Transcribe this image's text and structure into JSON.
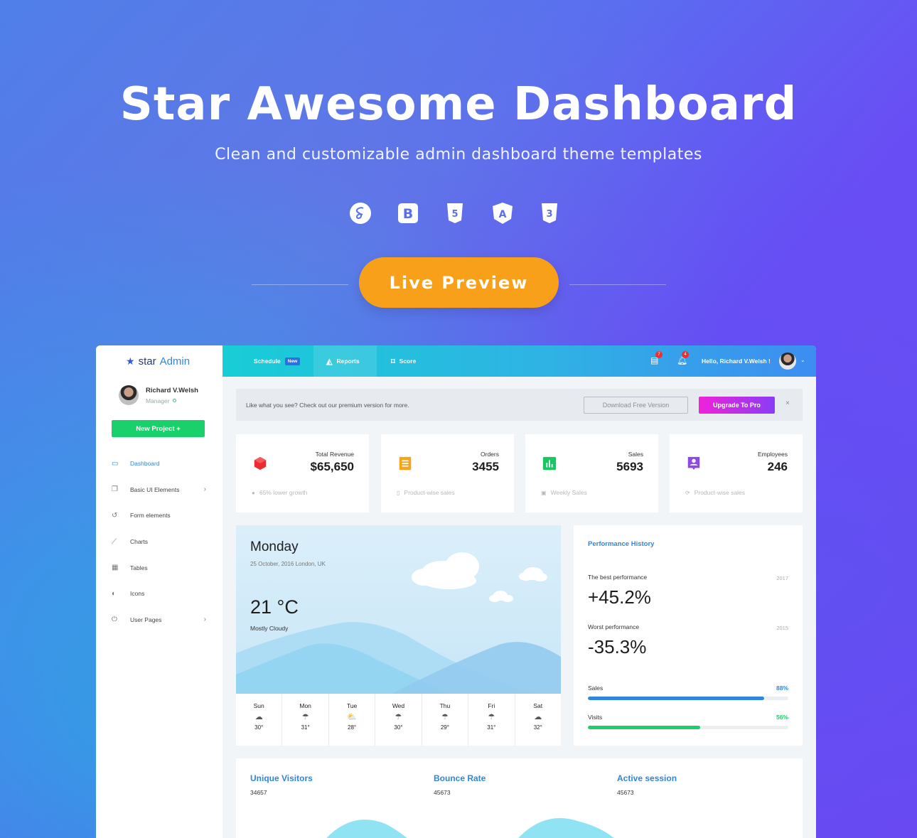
{
  "hero": {
    "title": "Star Awesome Dashboard",
    "subtitle": "Clean and customizable admin dashboard theme templates",
    "tech_icons": [
      "sass-icon",
      "bootstrap-icon",
      "html5-icon",
      "angular-icon",
      "css3-icon"
    ],
    "cta_label": "Live Preview"
  },
  "colors": {
    "accent_orange": "#f9a01a",
    "brand_blue": "#2e86de",
    "green": "#19d06a",
    "magenta": "#f022d9"
  },
  "sidebar": {
    "brand_star": "★",
    "brand_part1": "star",
    "brand_part2": "Admin",
    "user_name": "Richard V.Welsh",
    "user_role": "Manager",
    "new_project": "New Project  +",
    "items": [
      {
        "label": "Dashboard",
        "icon": "monitor-icon",
        "glyph": "▭",
        "active": true
      },
      {
        "label": "Basic UI Elements",
        "icon": "copy-icon",
        "glyph": "❐",
        "chevron": true
      },
      {
        "label": "Form elements",
        "icon": "history-icon",
        "glyph": "↺"
      },
      {
        "label": "Charts",
        "icon": "chart-line-icon",
        "glyph": "⟋"
      },
      {
        "label": "Tables",
        "icon": "table-icon",
        "glyph": "▦"
      },
      {
        "label": "Icons",
        "icon": "palette-icon",
        "glyph": "◐"
      },
      {
        "label": "User Pages",
        "icon": "power-icon",
        "glyph": "⏻",
        "chevron": true
      }
    ]
  },
  "topbar": {
    "tab_schedule": "Schedule",
    "tab_schedule_badge": "New",
    "tab_reports": "Reports",
    "tab_score": "Score",
    "messages_count": "7",
    "bell_count": "4",
    "greeting": "Hello, Richard V.Welsh !"
  },
  "promo": {
    "text": "Like what you see? Check out our premium version for more.",
    "download_label": "Download Free Version",
    "upgrade_label": "Upgrade To Pro",
    "close": "×"
  },
  "stats": [
    {
      "label": "Total Revenue",
      "value": "$65,650",
      "foot": "65% lower growth",
      "icon": "cube-icon",
      "color": "#ea2b2f"
    },
    {
      "label": "Orders",
      "value": "3455",
      "foot": "Product-wise sales",
      "icon": "receipt-icon",
      "color": "#f7a41d"
    },
    {
      "label": "Sales",
      "value": "5693",
      "foot": "Weekly Sales",
      "icon": "bar-chart-icon",
      "color": "#19c663"
    },
    {
      "label": "Employees",
      "value": "246",
      "foot": "Product-wise sales",
      "icon": "account-box-icon",
      "color": "#8f49e3"
    }
  ],
  "weather": {
    "day": "Monday",
    "date": "25 October, 2016 London, UK",
    "temp": "21 °C",
    "condition": "Mostly Cloudy",
    "forecast": [
      {
        "day": "Sun",
        "temp": "30°",
        "icon": "cloud-icon",
        "glyph": "☁"
      },
      {
        "day": "Mon",
        "temp": "31°",
        "icon": "cloud-drizzle-icon",
        "glyph": "☂"
      },
      {
        "day": "Tue",
        "temp": "28°",
        "icon": "partly-cloudy-icon",
        "glyph": "⛅"
      },
      {
        "day": "Wed",
        "temp": "30°",
        "icon": "cloud-rain-icon",
        "glyph": "☂"
      },
      {
        "day": "Thu",
        "temp": "29°",
        "icon": "cloud-rain-icon",
        "glyph": "☂"
      },
      {
        "day": "Fri",
        "temp": "31°",
        "icon": "cloud-rain-icon",
        "glyph": "☂"
      },
      {
        "day": "Sat",
        "temp": "32°",
        "icon": "cloud-download-icon",
        "glyph": "☁"
      }
    ]
  },
  "performance": {
    "title": "Performance History",
    "best_label": "The best performance",
    "best_year": "2017",
    "best_value": "+45.2%",
    "worst_label": "Worst performance",
    "worst_year": "2015",
    "worst_value": "-35.3%",
    "sales_label": "Sales",
    "sales_pct": "88%",
    "sales_fraction": 0.88,
    "visits_label": "Visits",
    "visits_pct": "56%",
    "visits_fraction": 0.56
  },
  "visitors": [
    {
      "title": "Unique Visitors",
      "value": "34657"
    },
    {
      "title": "Bounce Rate",
      "value": "45673"
    },
    {
      "title": "Active session",
      "value": "45673"
    }
  ]
}
